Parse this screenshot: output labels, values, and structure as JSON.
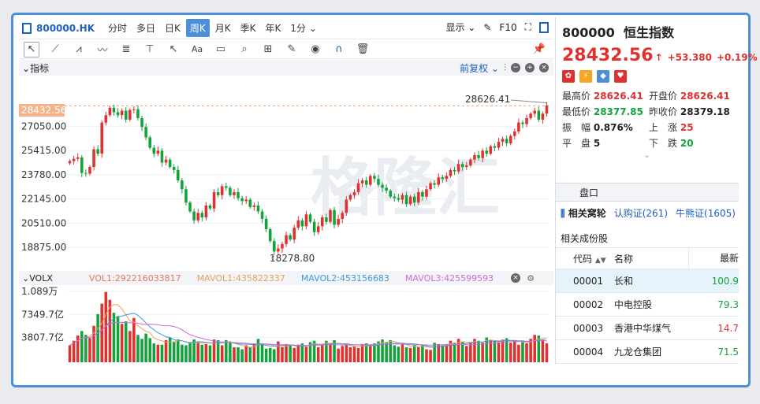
{
  "toolbar": {
    "ticker": "800000.HK",
    "periods": [
      "分时",
      "多日",
      "日K",
      "周K",
      "月K",
      "季K",
      "年K",
      "1分"
    ],
    "active_period": "周K",
    "display_label": "显示",
    "f10_label": "F10"
  },
  "indicator": {
    "label": "指标",
    "adjust_label": "前复权"
  },
  "chart_data": {
    "type": "candlestick",
    "y_ticks": [
      "27050.00",
      "25415.00",
      "23780.00",
      "22145.00",
      "20510.00",
      "18875.00"
    ],
    "current_price_tag": "28432.56",
    "high_annotation": "28626.41",
    "low_annotation": "18278.80",
    "ylim": [
      17500,
      29300
    ],
    "candles": [
      24700,
      24850,
      24950,
      23900,
      23850,
      24300,
      25500,
      25200,
      27300,
      27800,
      28300,
      28000,
      27800,
      28100,
      27500,
      28150,
      28200,
      27600,
      27000,
      26300,
      25600,
      25200,
      25400,
      24600,
      24800,
      24300,
      24100,
      23400,
      22800,
      21900,
      21300,
      20700,
      21200,
      20900,
      21700,
      21500,
      22600,
      22400,
      23000,
      22900,
      22400,
      22600,
      22200,
      22000,
      22100,
      21600,
      21700,
      21300,
      20800,
      20100,
      19300,
      18600,
      18800,
      19100,
      19700,
      19400,
      20200,
      20700,
      20300,
      21100,
      20600,
      19900,
      20300,
      20900,
      20600,
      21400,
      20400,
      20800,
      21200,
      22100,
      22400,
      22600,
      23200,
      23400,
      23100,
      23700,
      23500,
      23100,
      22900,
      22700,
      22300,
      22200,
      22100,
      22400,
      21800,
      22300,
      21900,
      22600,
      22300,
      22800,
      23200,
      23100,
      23600,
      23500,
      23700,
      24100,
      24000,
      24500,
      24300,
      24400,
      24800,
      25100,
      24900,
      25400,
      25200,
      25700,
      25600,
      26000,
      26200,
      25900,
      26400,
      26700,
      27300,
      27200,
      27600,
      27900,
      28100,
      27500,
      27900,
      28450
    ],
    "volume": {
      "legend": [
        "VOL1:292216033817",
        "MAVOL1:435822337",
        "MAVOL2:453156683",
        "MAVOL3:425599593"
      ],
      "legend_colors": [
        "#e8745c",
        "#e8a05c",
        "#3b9ad9",
        "#d16ad6"
      ],
      "y_ticks": [
        "1.089万",
        "7349.7亿",
        "3807.7亿"
      ],
      "ylim": [
        0,
        10890
      ],
      "values": [
        2600,
        3300,
        4100,
        4800,
        4200,
        3700,
        5600,
        7400,
        9000,
        10800,
        9600,
        7600,
        7100,
        5900,
        6300,
        4800,
        6800,
        4200,
        3600,
        4400,
        3700,
        2900,
        2700,
        2700,
        3400,
        3800,
        3100,
        3500,
        2700,
        2600,
        3000,
        3500,
        3100,
        2700,
        2800,
        2600,
        3500,
        3400,
        2600,
        3400,
        3000,
        2300,
        2300,
        2000,
        2600,
        2300,
        2900,
        3600,
        2800,
        2100,
        2200,
        2000,
        3200,
        2300,
        2800,
        2600,
        2200,
        2700,
        2900,
        2400,
        3100,
        3300,
        2300,
        2800,
        3300,
        2900,
        3400,
        2100,
        2500,
        2700,
        2300,
        2500,
        2200,
        2800,
        2900,
        2500,
        2900,
        3200,
        3500,
        3100,
        3400,
        2600,
        2400,
        2800,
        2300,
        2200,
        2700,
        2300,
        2600,
        2000,
        1900,
        3000,
        2800,
        2600,
        2800,
        3300,
        3000,
        3600,
        3100,
        2500,
        3100,
        3600,
        3300,
        3000,
        3800,
        3400,
        3200,
        3100,
        3500,
        3700,
        3000,
        3400,
        2700,
        3100,
        2900,
        3600,
        4200,
        4100,
        3500,
        2900
      ]
    }
  },
  "side": {
    "code": "800000",
    "name": "恒生指数",
    "price": "28432.56",
    "arrow": "↑",
    "change": "+53.380",
    "change_pct": "+0.19%",
    "stats": {
      "high_label": "最高价",
      "high": "28626.41",
      "open_label": "开盘价",
      "open": "28626.41",
      "low_label": "最低价",
      "low": "28377.85",
      "prev_label": "昨收价",
      "prev": "28379.18",
      "amp_label": "振　幅",
      "amp": "0.876%",
      "up_label": "上　涨",
      "up": "25",
      "flat_label": "平　盘",
      "flat": "5",
      "down_label": "下　跌",
      "down": "20"
    },
    "pankou": "盘口",
    "rel_tabs": [
      "相关窝轮",
      "认购证(261)",
      "牛熊证(1605)"
    ],
    "constituents_title": "相关成份股",
    "table": {
      "headers": [
        "代码",
        "名称",
        "最新"
      ],
      "rows": [
        {
          "code": "00001",
          "name": "长和",
          "price": "100.9",
          "color": "#12a33a"
        },
        {
          "code": "00002",
          "name": "中电控股",
          "price": "79.3",
          "color": "#12a33a"
        },
        {
          "code": "00003",
          "name": "香港中华煤气",
          "price": "14.7",
          "color": "#e03131"
        },
        {
          "code": "00004",
          "name": "九龙仓集团",
          "price": "71.5",
          "color": "#12a33a"
        }
      ]
    }
  }
}
